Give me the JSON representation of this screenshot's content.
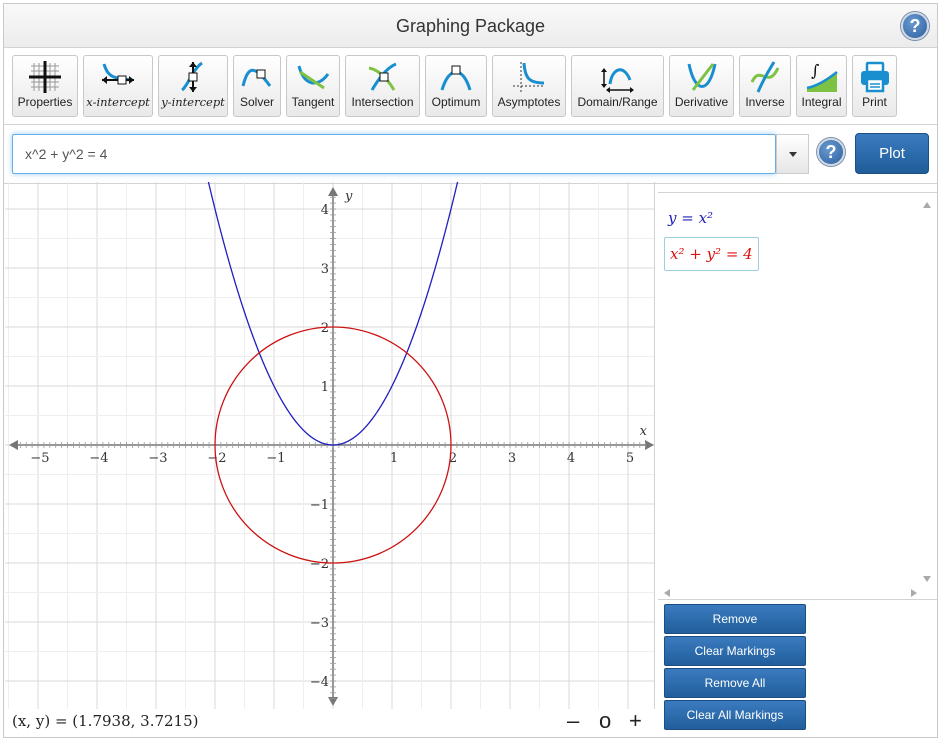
{
  "app": {
    "title": "Graphing Package"
  },
  "toolbar": {
    "tools": [
      {
        "label": "Properties",
        "icon": "grid-crosshair-icon"
      },
      {
        "label": "x-intercept",
        "icon": "x-intercept-icon"
      },
      {
        "label": "y-intercept",
        "icon": "y-intercept-icon"
      },
      {
        "label": "Solver",
        "icon": "solver-icon"
      },
      {
        "label": "Tangent",
        "icon": "tangent-icon"
      },
      {
        "label": "Intersection",
        "icon": "intersection-icon"
      },
      {
        "label": "Optimum",
        "icon": "optimum-icon"
      },
      {
        "label": "Asymptotes",
        "icon": "asymptotes-icon"
      },
      {
        "label": "Domain/Range",
        "icon": "domain-range-icon"
      },
      {
        "label": "Derivative",
        "icon": "derivative-icon"
      },
      {
        "label": "Inverse",
        "icon": "inverse-icon"
      },
      {
        "label": "Integral",
        "icon": "integral-icon"
      },
      {
        "label": "Print",
        "icon": "printer-icon"
      }
    ]
  },
  "input": {
    "value": "x^2 + y^2 = 4",
    "plot_label": "Plot"
  },
  "graph": {
    "x_axis_label": "x",
    "y_axis_label": "y",
    "x_ticks": [
      "−5",
      "−4",
      "−3",
      "−2",
      "−1",
      "1",
      "2",
      "3",
      "4",
      "5"
    ],
    "y_ticks": [
      "4",
      "3",
      "2",
      "1",
      "−1",
      "−2",
      "−3",
      "−4"
    ],
    "curves": [
      {
        "equation": "y = x^2",
        "color": "#1f1fbf"
      },
      {
        "equation": "x^2 + y^2 = 4",
        "color": "#cc1111"
      }
    ],
    "x_range": [
      -5.5,
      5.5
    ],
    "y_range": [
      -4.4,
      4.5
    ]
  },
  "status": {
    "coord_text": "(x, y) = (1.7938, 3.7215)",
    "zoom_out": "–",
    "zoom_reset": "o",
    "zoom_in": "+"
  },
  "panel": {
    "eq1_display": "y = x²",
    "eq2_display": "x² + y² = 4"
  },
  "actions": {
    "remove": "Remove",
    "clear_markings": "Clear Markings",
    "remove_all": "Remove All",
    "clear_all_markings": "Clear All Markings"
  },
  "colors": {
    "accent": "#2a68a8",
    "curve_parabola": "#1f1fbf",
    "curve_circle": "#cc1111"
  }
}
